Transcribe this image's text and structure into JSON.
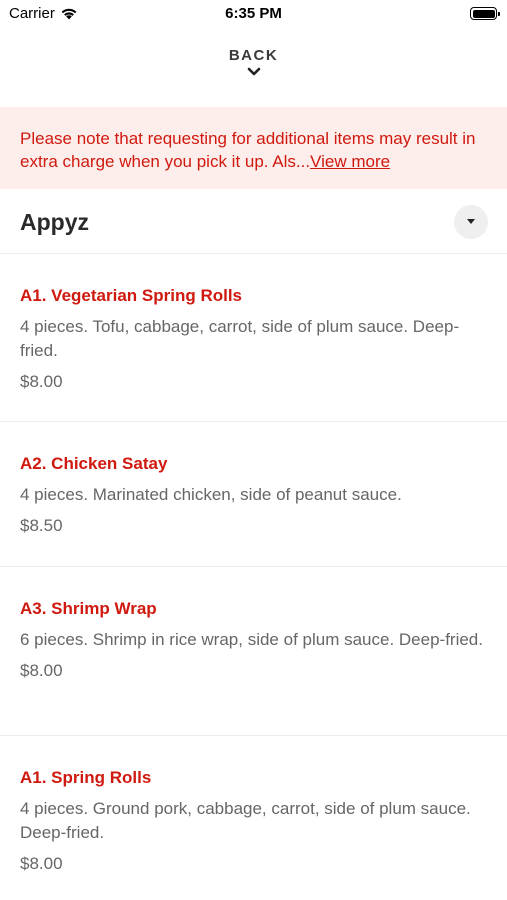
{
  "status_bar": {
    "carrier": "Carrier",
    "time": "6:35 PM"
  },
  "nav": {
    "back_label": "BACK"
  },
  "notice": {
    "text": "Please note that requesting for additional items may result in extra charge when you pick it up. Als...",
    "link_label": "View more"
  },
  "section": {
    "title": "Appyz"
  },
  "items": [
    {
      "name": "A1. Vegetarian Spring Rolls",
      "description": "4 pieces.  Tofu, cabbage, carrot, side of plum sauce. Deep-fried.",
      "price": "$8.00"
    },
    {
      "name": "A2. Chicken Satay",
      "description": "4 pieces.  Marinated chicken, side of peanut sauce.",
      "price": "$8.50"
    },
    {
      "name": "A3. Shrimp Wrap",
      "description": "6 pieces. Shrimp in rice wrap, side of plum sauce. Deep-fried.",
      "price": "$8.00"
    },
    {
      "name": "A1. Spring Rolls",
      "description": "4 pieces.  Ground pork, cabbage, carrot, side of plum sauce. Deep-fried.",
      "price": "$8.00"
    }
  ],
  "colors": {
    "accent": "#d0190f",
    "notice_bg": "#fdeeeb"
  },
  "icons": {
    "status_signal": "wifi-icon",
    "status_battery": "battery-icon",
    "back": "chevron-down-icon",
    "section_toggle": "caret-down-icon"
  }
}
